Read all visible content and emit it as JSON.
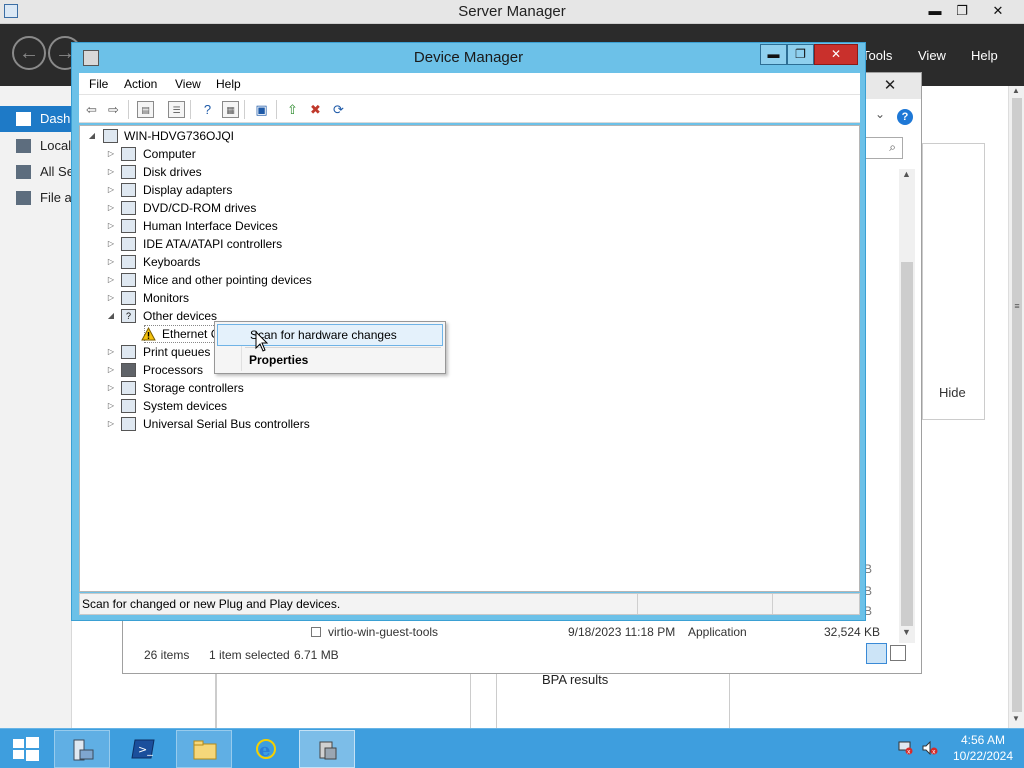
{
  "server_manager": {
    "title": "Server Manager",
    "window_buttons": {
      "minimize": "▬",
      "maximize": "❐",
      "close": "✕"
    },
    "menu": {
      "tools": "Tools",
      "view": "View",
      "help": "Help"
    },
    "sidebar": [
      {
        "label": "Dash"
      },
      {
        "label": "Local"
      },
      {
        "label": "All Se"
      },
      {
        "label": "File a"
      }
    ],
    "hide_label": "Hide",
    "bpa_label": "BPA results"
  },
  "explorer": {
    "close": "✕",
    "help": "?",
    "search_icon": "⌕",
    "file_row": {
      "name": "virtio-win-guest-tools",
      "date": "9/18/2023 11:18 PM",
      "type": "Application",
      "size": "32,524 KB"
    },
    "size_fragments": [
      "B",
      "B",
      "B"
    ],
    "status": {
      "count": "26 items",
      "selected": "1 item selected",
      "size": "6.71 MB"
    }
  },
  "device_manager": {
    "title": "Device Manager",
    "window_buttons": {
      "minimize": "▬",
      "maximize": "❐",
      "close": "✕"
    },
    "menu": [
      "File",
      "Action",
      "View",
      "Help"
    ],
    "tree": {
      "root": "WIN-HDVG736OJQI",
      "categories": [
        {
          "label": "Computer",
          "expanded": false
        },
        {
          "label": "Disk drives",
          "expanded": false
        },
        {
          "label": "Display adapters",
          "expanded": false
        },
        {
          "label": "DVD/CD-ROM drives",
          "expanded": false
        },
        {
          "label": "Human Interface Devices",
          "expanded": false
        },
        {
          "label": "IDE ATA/ATAPI controllers",
          "expanded": false
        },
        {
          "label": "Keyboards",
          "expanded": false
        },
        {
          "label": "Mice and other pointing devices",
          "expanded": false
        },
        {
          "label": "Monitors",
          "expanded": false
        },
        {
          "label": "Other devices",
          "expanded": true
        },
        {
          "label": "Print queues",
          "expanded": false
        },
        {
          "label": "Processors",
          "expanded": false
        },
        {
          "label": "Storage controllers",
          "expanded": false
        },
        {
          "label": "System devices",
          "expanded": false
        },
        {
          "label": "Universal Serial Bus controllers",
          "expanded": false
        }
      ],
      "child_device": {
        "label": "Ethernet C",
        "status_icon": "warning-icon"
      }
    },
    "status_text": "Scan for changed or new Plug and Play devices."
  },
  "context_menu": {
    "items": [
      {
        "label": "Scan for hardware changes",
        "highlighted": true,
        "bold": false
      },
      {
        "label": "Properties",
        "highlighted": false,
        "bold": true
      }
    ]
  },
  "taskbar": {
    "apps": [
      {
        "name": "server-manager",
        "state": "open"
      },
      {
        "name": "powershell",
        "state": "normal"
      },
      {
        "name": "file-explorer",
        "state": "open"
      },
      {
        "name": "internet-explorer",
        "state": "normal"
      },
      {
        "name": "device-manager",
        "state": "active"
      }
    ],
    "clock": {
      "time": "4:56 AM",
      "date": "10/22/2024"
    }
  },
  "colors": {
    "dm_frame": "#6cc1e8",
    "taskbar": "#3e9ede",
    "selection": "#e4f1fb",
    "close_red": "#c9302c",
    "sidebar_active": "#1e7ac7"
  }
}
